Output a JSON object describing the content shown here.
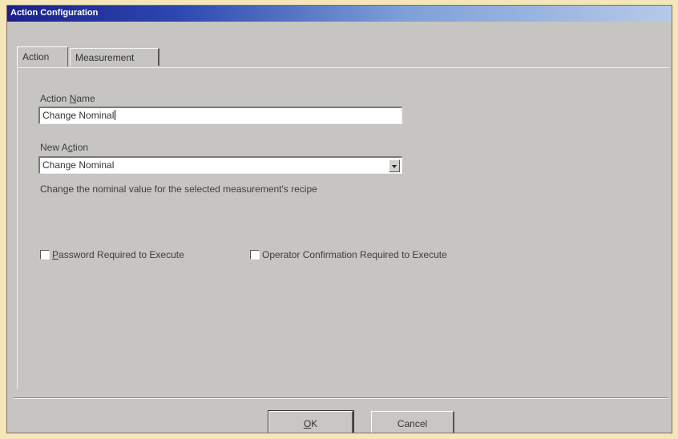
{
  "window": {
    "title": "Action Configuration"
  },
  "tabs": [
    {
      "label": "Action",
      "active": true
    },
    {
      "label": "Measurement",
      "active": false
    }
  ],
  "action_name": {
    "label_before": "Action ",
    "label_mnemonic": "N",
    "label_after": "ame",
    "value": "Change Nominal"
  },
  "new_action": {
    "label_before": "New A",
    "label_mnemonic": "c",
    "label_after": "tion",
    "selected": "Change Nominal",
    "description": "Change the nominal value for the selected measurement's recipe"
  },
  "options": {
    "password": {
      "mnemonic": "P",
      "label_rest": "assword Required to Execute",
      "checked": false
    },
    "operator": {
      "label": "Operator Confirmation Required to Execute",
      "checked": false
    }
  },
  "buttons": {
    "ok_mnemonic": "O",
    "ok_rest": "K",
    "cancel": "Cancel"
  },
  "colors": {
    "titlebar_start": "#1a1f8a",
    "titlebar_end": "#b6c9e8",
    "dialog_bg": "#c6c5c1",
    "frame_bg": "#f3e6b8"
  }
}
